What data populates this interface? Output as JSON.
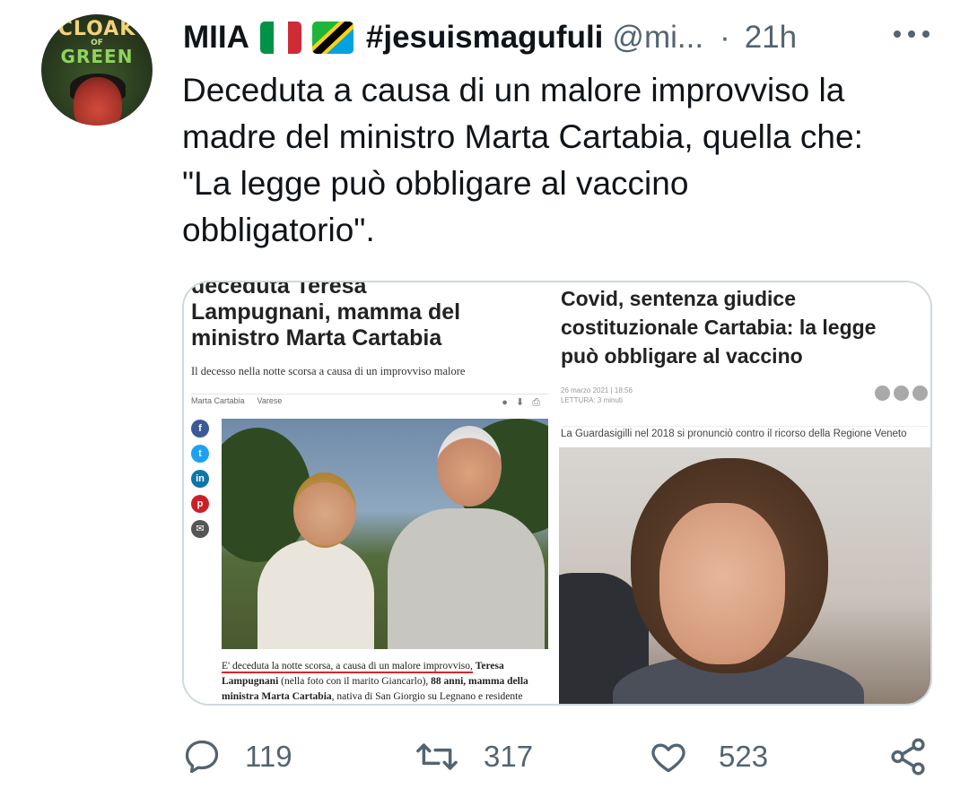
{
  "tweet": {
    "display_name": "MIIA",
    "hashtag": "#jesuismagufuli",
    "handle": "@mi...",
    "separator": "·",
    "timestamp": "21h",
    "avatar_text": [
      "CLOAK",
      "OF",
      "GREEN"
    ],
    "text_lines": [
      "Deceduta a causa di un malore improvviso la",
      "madre del ministro Marta Cartabia, quella che:",
      "\"La legge può obbligare al vaccino",
      "obbligatorio\"."
    ]
  },
  "media": {
    "left": {
      "headline_lines": [
        "deceduta Teresa",
        "Lampugnani, mamma del",
        "ministro Marta Cartabia"
      ],
      "subtitle": "Il decesso nella notte scorsa a causa di un improvviso malore",
      "tags": [
        "Marta Cartabia",
        "Varese"
      ],
      "body_highlight": "E' deceduta la notte scorsa, a causa di un malore improvviso,",
      "body_bold_1": "Teresa Lampugnani",
      "body_mid": "(nella foto con il marito Giancarlo),",
      "body_bold_2": "88 anni, mamma della ministra Marta Cartabia",
      "body_tail": ", nativa di San Giorgio su Legnano e residente"
    },
    "right": {
      "headline_lines": [
        "Covid, sentenza giudice",
        "costituzionale Cartabia: la legge",
        "può obbligare al vaccino"
      ],
      "date": "26 marzo 2021 | 18:56",
      "reading": "LETTURA: 3 minuti",
      "caption": "La Guardasigilli nel 2018 si pronunciò contro il ricorso della Regione Veneto"
    }
  },
  "actions": {
    "replies": "119",
    "retweets": "317",
    "likes": "523"
  },
  "colors": {
    "text_primary": "#0f1419",
    "text_secondary": "#536471",
    "border": "#cfd9de"
  },
  "icons": [
    "reply-icon",
    "retweet-icon",
    "like-icon",
    "share-icon",
    "more-icon",
    "italy-flag-icon",
    "tanzania-flag-icon"
  ]
}
